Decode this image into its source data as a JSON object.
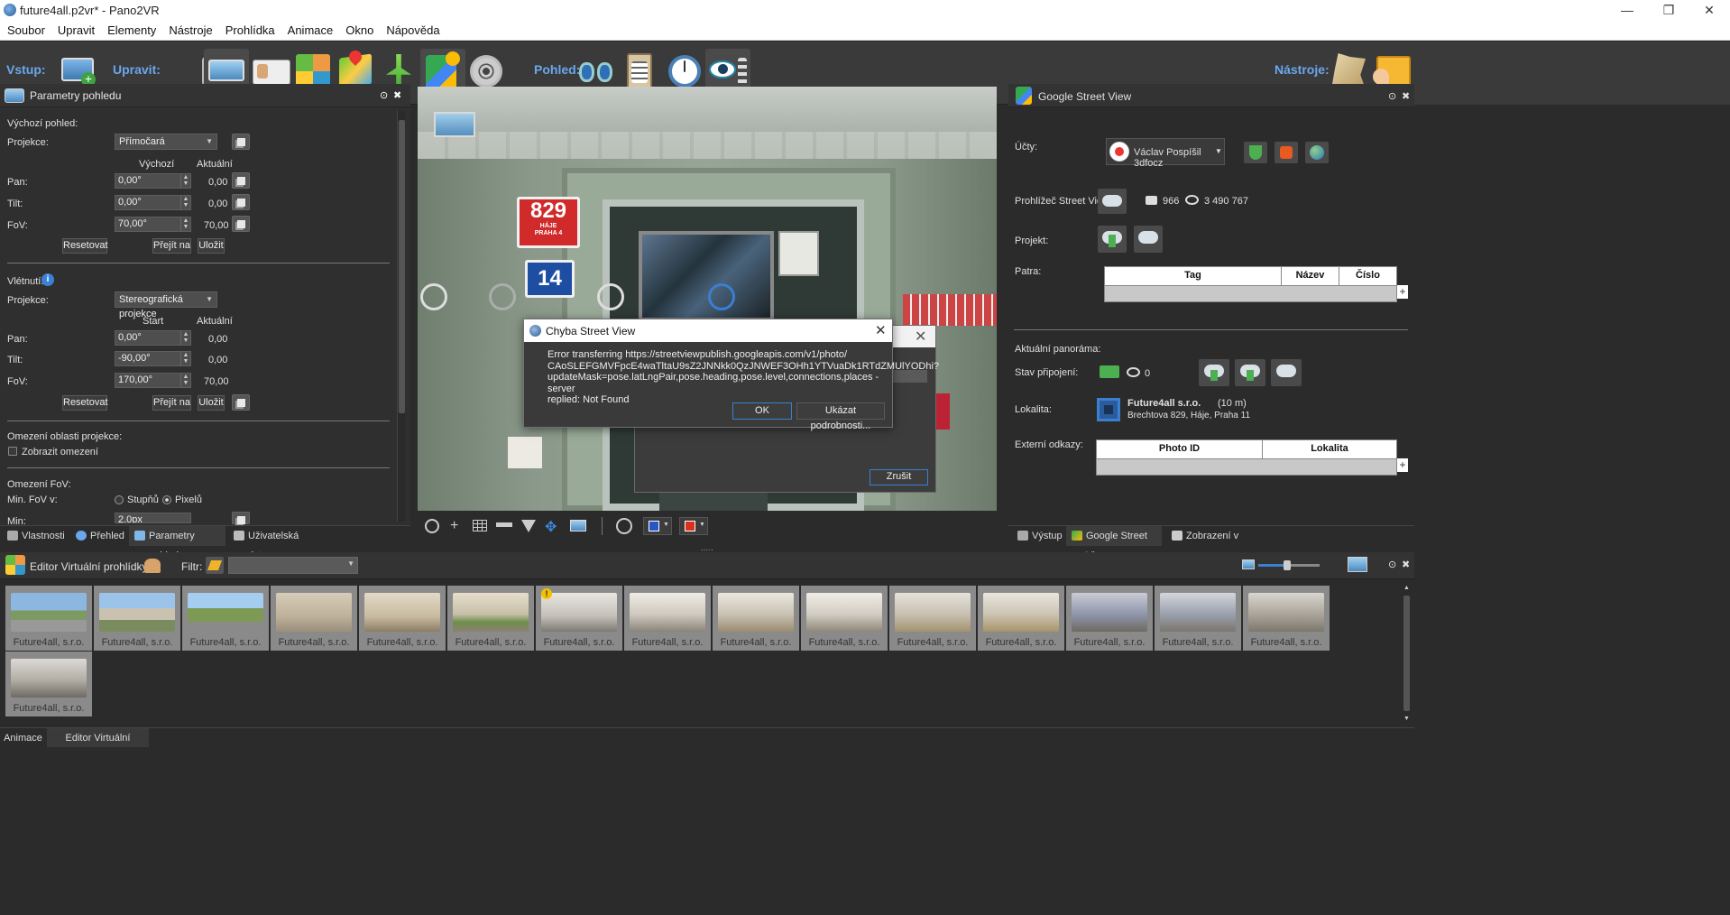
{
  "window": {
    "title": "future4all.p2vr* - Pano2VR",
    "minimize": "—",
    "maximize": "❐",
    "close": "✕"
  },
  "menu": [
    "Soubor",
    "Upravit",
    "Elementy",
    "Nástroje",
    "Prohlídka",
    "Animace",
    "Okno",
    "Nápověda"
  ],
  "toolbar": {
    "input_label": "Vstup:",
    "edit_label": "Upravit:",
    "view_label": "Pohled:",
    "tools_label": "Nástroje:"
  },
  "left_panel": {
    "title": "Parametry pohledu",
    "default_view": {
      "heading": "Výchozí pohled:",
      "projection_label": "Projekce:",
      "projection_value": "Přímočará",
      "col_default": "Výchozí",
      "col_current": "Aktuální",
      "pan_label": "Pan:",
      "pan_value": "0,00°",
      "pan_current": "0,00",
      "tilt_label": "Tilt:",
      "tilt_value": "0,00°",
      "tilt_current": "0,00",
      "fov_label": "FoV:",
      "fov_value": "70,00°",
      "fov_current": "70,00",
      "reset": "Resetovat",
      "goto": "Přejít na",
      "save": "Uložit"
    },
    "fly_in": {
      "heading": "Vlétnutí:",
      "projection_label": "Projekce:",
      "projection_value": "Stereografická projekce",
      "col_start": "Start",
      "col_current": "Aktuální",
      "pan_label": "Pan:",
      "pan_value": "0,00°",
      "pan_current": "0,00",
      "tilt_label": "Tilt:",
      "tilt_value": "-90,00°",
      "tilt_current": "0,00",
      "fov_label": "FoV:",
      "fov_value": "170,00°",
      "fov_current": "70,00",
      "reset": "Resetovat",
      "goto": "Přejít na",
      "save": "Uložit"
    },
    "limits": {
      "heading": "Omezení oblasti projekce:",
      "show_limits": "Zobrazit omezení"
    },
    "fov_limits": {
      "heading": "Omezení FoV:",
      "min_fov_in": "Min. FoV v:",
      "degrees": "Stupňů",
      "pixels": "Pixelů",
      "min_label": "Min:",
      "min_value": "2,0px"
    },
    "tabs": [
      "Vlastnosti",
      "Přehled",
      "Parametry pohledu",
      "Uživatelská data"
    ]
  },
  "viewport": {
    "sign_number": "829",
    "sign_sub": "HÁJE\nPRAHA 4",
    "sign_14": "14"
  },
  "dialog_back": {
    "cancel": "Zrušit"
  },
  "error_dialog": {
    "title": "Chyba Street View",
    "message_1": "Error transferring https://streetviewpublish.googleapis.com/v1/photo/",
    "message_2": "CAoSLEFGMVFpcE4waTltaU9sZ2JNNkk0QzJNWEF3OHh1YTVuaDk1RTdZMUlYODhi?",
    "message_3": "updateMask=pose.latLngPair,pose.heading,pose.level,connections,places - server",
    "message_4": "replied: Not Found",
    "ok": "OK",
    "details": "Ukázat podrobnosti..."
  },
  "right_panel": {
    "title": "Google Street View",
    "accounts_label": "Účty:",
    "account_name": "Václav Pospíšil 3dfocz",
    "browser_label": "Prohlížeč Street View:",
    "photo_count": "966",
    "view_count": "3 490 767",
    "project_label": "Projekt:",
    "floors_label": "Patra:",
    "floors_cols": [
      "Tag",
      "Název",
      "Číslo"
    ],
    "current_pano_label": "Aktuální panoráma:",
    "connection_label": "Stav připojení:",
    "connection_views": "0",
    "location_label": "Lokalita:",
    "location_name": "Future4all s.r.o.",
    "location_distance": "(10 m)",
    "location_address": "Brechtova 829, Háje, Praha 11",
    "external_label": "Externí odkazy:",
    "external_cols": [
      "Photo ID",
      "Lokalita"
    ],
    "tabs": [
      "Výstup",
      "Google Street View",
      "Zobrazení v seznamu"
    ]
  },
  "tour_editor": {
    "title": "Editor Virtuální prohlídky",
    "filter_label": "Filtr:",
    "thumbs": [
      "Future4all, s.r.o.",
      "Future4all, s.r.o.",
      "Future4all, s.r.o.",
      "Future4all, s.r.o.",
      "Future4all, s.r.o.",
      "Future4all, s.r.o.",
      "Future4all, s.r.o.",
      "Future4all, s.r.o.",
      "Future4all, s.r.o.",
      "Future4all, s.r.o.",
      "Future4all, s.r.o.",
      "Future4all, s.r.o.",
      "Future4all, s.r.o.",
      "Future4all, s.r.o.",
      "Future4all, s.r.o.",
      "Future4all, s.r.o."
    ]
  },
  "bottom_tabs": [
    "Animace",
    "Editor Virtuální prohlídky"
  ]
}
